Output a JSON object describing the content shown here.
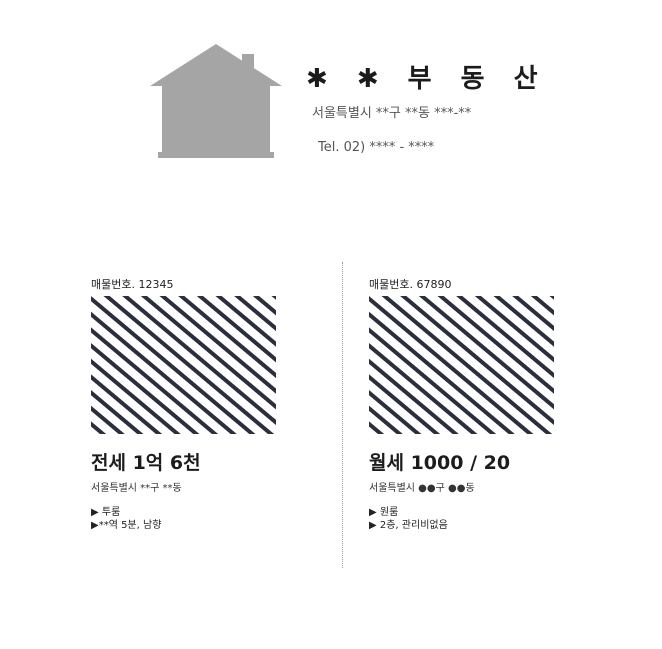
{
  "agency": {
    "name": "✱ ✱ 부 동 산",
    "address": "서울특별시 **구 **동 ***-**",
    "tel": "Tel. 02) **** - ****",
    "logo_color": "#a5a5a5"
  },
  "listings": [
    {
      "number_label": "매물번호. 12345",
      "price": "전세 1억 6천",
      "address": "서울특별시 **구 **동",
      "features": [
        "▶ 투룸",
        "▶**역 5분, 남향"
      ]
    },
    {
      "number_label": "매물번호. 67890",
      "price": "월세 1000 / 20",
      "address": "서울특별시 ●●구 ●●동",
      "features": [
        "▶ 원룸",
        "▶ 2층, 관리비없음"
      ]
    }
  ],
  "colors": {
    "stripe": "#2b2f3d",
    "divider": "#9a9a9a"
  }
}
